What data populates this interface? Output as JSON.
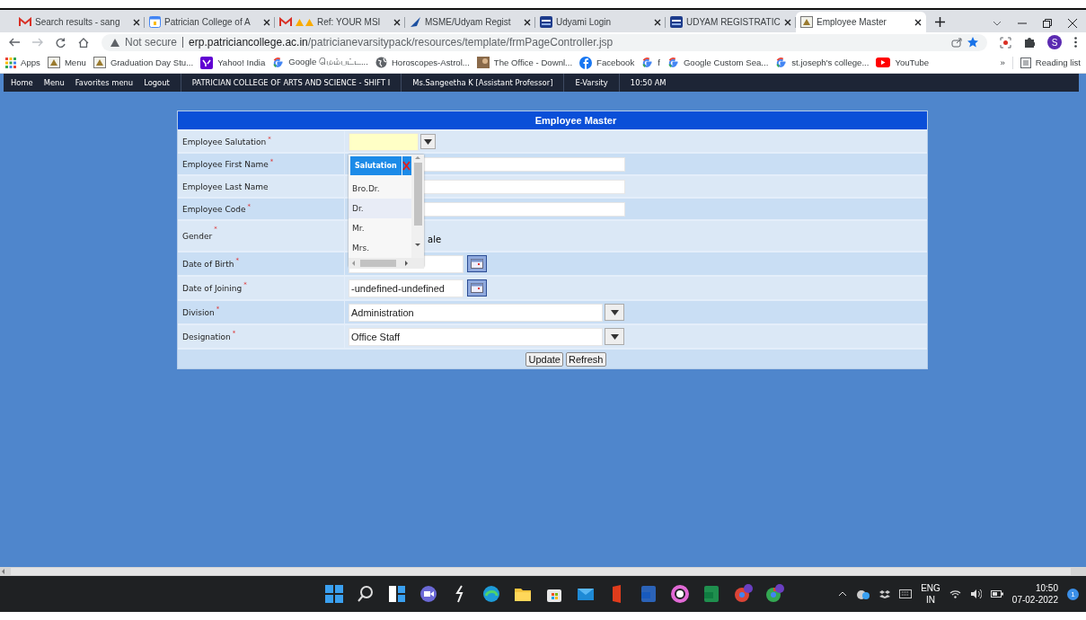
{
  "browser_tabs": [
    {
      "title": "Search results - sang",
      "kind": "mail",
      "selected": false
    },
    {
      "title": "Patrician College of A",
      "kind": "calendar",
      "selected": false
    },
    {
      "title": "Ref: YOUR MSI",
      "kind": "mail-warning",
      "selected": false
    },
    {
      "title": "MSME/Udyam Regist",
      "kind": "feather",
      "selected": false
    },
    {
      "title": "Udyami Login",
      "kind": "portal",
      "selected": false
    },
    {
      "title": "UDYAM REGISTRATIC",
      "kind": "portal",
      "selected": false
    },
    {
      "title": "Employee Master",
      "kind": "crest",
      "selected": true
    }
  ],
  "address_bar": {
    "security": "Not secure",
    "host": "erp.patriciancollege.ac.in",
    "path": "/patricianevarsitypack/resources/template/frmPageController.jsp"
  },
  "profile_initial": "S",
  "bookmarks": [
    {
      "label": "Apps",
      "kind": "apps"
    },
    {
      "label": "Menu",
      "kind": "crest"
    },
    {
      "label": "Graduation Day Stu...",
      "kind": "crest"
    },
    {
      "label": "Yahoo! India",
      "kind": "yahoo"
    },
    {
      "label": "Google மெம்பட்ட...",
      "kind": "google"
    },
    {
      "label": "Horoscopes-Astrol...",
      "kind": "globe"
    },
    {
      "label": "The Office - Downl...",
      "kind": "photo"
    },
    {
      "label": "Facebook",
      "kind": "facebook"
    },
    {
      "label": "f",
      "kind": "google"
    },
    {
      "label": "Google Custom Sea...",
      "kind": "google"
    },
    {
      "label": "st.joseph's college...",
      "kind": "google"
    },
    {
      "label": "YouTube",
      "kind": "youtube"
    }
  ],
  "bookmarks_overflow": "»",
  "reading_list": "Reading list",
  "nav_links": [
    "Home",
    "Menu",
    "Favorites menu",
    "Logout"
  ],
  "nav_info": [
    "PATRICIAN COLLEGE OF ARTS AND SCIENCE - SHIFT I",
    "Ms.Sangeetha K [Assistant Professor]",
    "E-Varsity",
    "10:50 AM"
  ],
  "form": {
    "title": "Employee Master",
    "fields": [
      {
        "label": "Employee Salutation",
        "mark": "*",
        "kind": "select",
        "focused": true
      },
      {
        "label": "Employee First Name",
        "mark": "*",
        "kind": "text"
      },
      {
        "label": "Employee Last Name",
        "kind": "text"
      },
      {
        "label": "Employee Code",
        "mark": "*",
        "kind": "text"
      },
      {
        "label": "Gender",
        "mark": "*",
        "kind": "radio",
        "value_fragment": "ale"
      },
      {
        "label": "Date of Birth",
        "mark": "*",
        "kind": "date"
      },
      {
        "label": "Date of Joining",
        "mark": "*",
        "kind": "date",
        "value": "-undefined-undefined"
      },
      {
        "label": "Division",
        "mark": "*",
        "kind": "wide-select",
        "value": "Administration"
      },
      {
        "label": "Designation",
        "mark": "*",
        "kind": "wide-select",
        "value": "Office Staff"
      }
    ],
    "buttons": [
      "Update",
      "Refresh"
    ]
  },
  "salutation_popup": {
    "header": "Salutation",
    "items": [
      {
        "label": "Bro.Dr.",
        "highlighted": false
      },
      {
        "label": "Dr.",
        "highlighted": true
      },
      {
        "label": "Mr.",
        "highlighted": false
      },
      {
        "label": "Mrs.",
        "highlighted": false
      }
    ]
  },
  "taskbar": {
    "language": "ENG",
    "region": "IN",
    "time": "10:50",
    "date": "07-02-2022",
    "notifications": "1"
  }
}
